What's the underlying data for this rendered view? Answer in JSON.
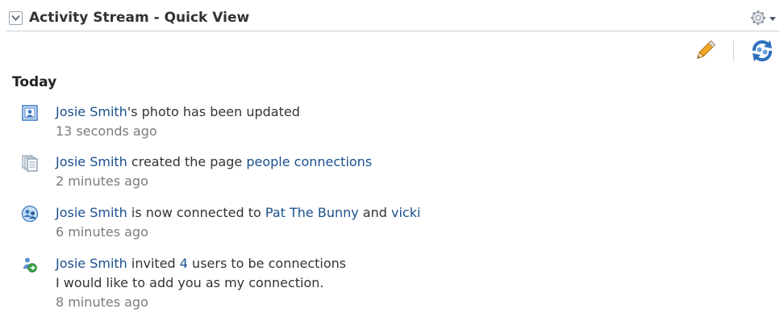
{
  "header": {
    "title": "Activity Stream - Quick View"
  },
  "section": {
    "heading": "Today"
  },
  "activities": [
    {
      "icon": "profile-photo-icon",
      "actor": "Josie Smith",
      "text1": "'s photo has been updated",
      "time": "13 seconds ago"
    },
    {
      "icon": "page-icon",
      "actor": "Josie Smith",
      "text1": " created the page ",
      "target": "people connections",
      "time": "2 minutes ago"
    },
    {
      "icon": "connections-icon",
      "actor": "Josie Smith",
      "text1": " is now connected to ",
      "target1": "Pat The Bunny",
      "text2": " and ",
      "target2": "vicki",
      "time": "6 minutes ago"
    },
    {
      "icon": "invite-icon",
      "actor": "Josie Smith",
      "text1": " invited ",
      "count": "4",
      "text2": " users to be connections",
      "message": "I would like to add you as my connection.",
      "time": "8 minutes ago"
    }
  ],
  "colors": {
    "link": "#1a4f8e",
    "timestamp": "#7b7b7b",
    "accent_icon": "#3a78c4"
  }
}
